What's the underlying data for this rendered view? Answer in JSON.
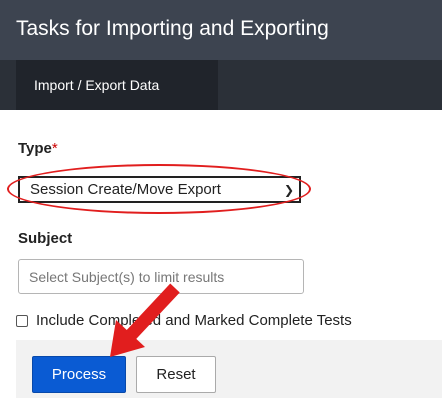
{
  "header": {
    "title": "Tasks for Importing and Exporting"
  },
  "subnav": {
    "active_tab": "Import / Export Data"
  },
  "form": {
    "type_label": "Type",
    "required_marker": "*",
    "type_value": "Session Create/Move Export",
    "subject_label": "Subject",
    "subject_placeholder": "Select Subject(s) to limit results",
    "include_completed_label": "Include Completed and Marked Complete Tests",
    "include_completed_checked": false
  },
  "actions": {
    "process_label": "Process",
    "reset_label": "Reset"
  },
  "colors": {
    "header_bg": "#3d4450",
    "primary_button": "#0a5bd3",
    "annotation_red": "#e11e1e"
  }
}
